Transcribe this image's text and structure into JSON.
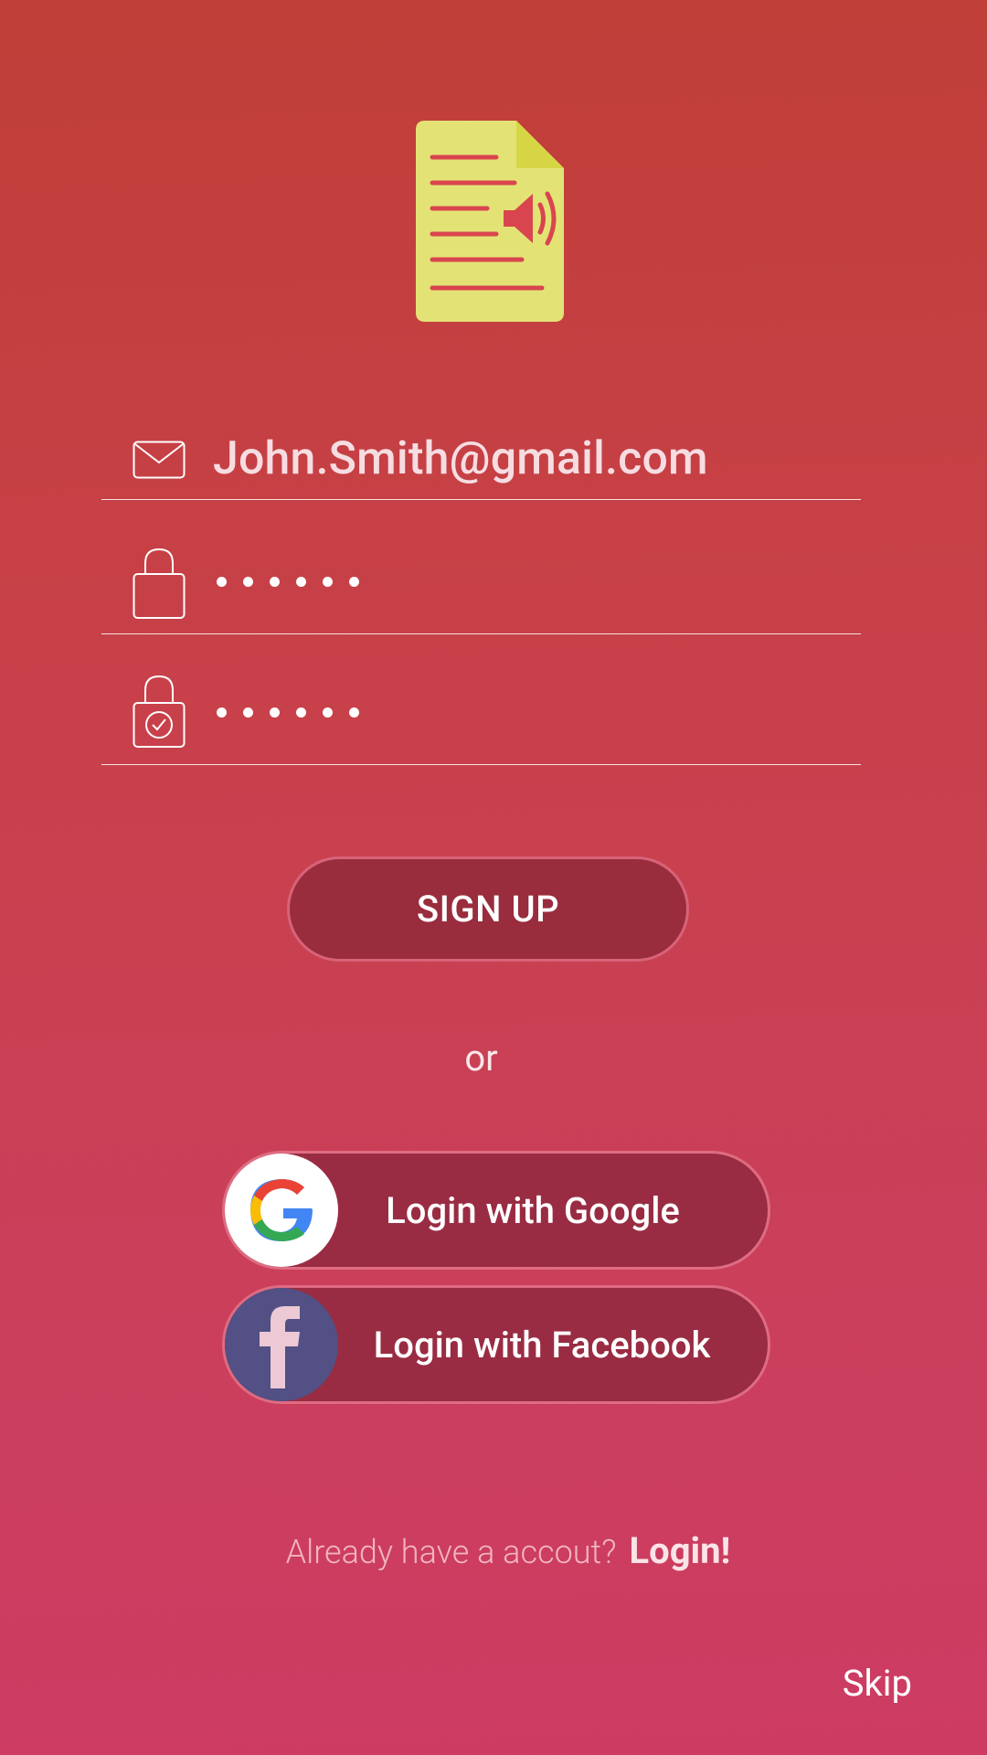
{
  "app": {
    "logo_icon": "document-speaker-icon",
    "colors": {
      "background_top": "#c03f38",
      "background_bottom": "#cd3b63",
      "logo_yellow": "#e3e375",
      "button_fill": "#992c3d",
      "facebook_blue": "#525085"
    }
  },
  "form": {
    "email": {
      "icon": "envelope-icon",
      "value": "John.Smith@gmail.com"
    },
    "password": {
      "icon": "lock-icon",
      "masked_value": "••••••"
    },
    "confirm_password": {
      "icon": "lock-check-icon",
      "masked_value": "••••••"
    },
    "signup_label": "SIGN UP"
  },
  "separator": "or",
  "social": {
    "google_label": "Login with Google",
    "google_icon": "google-g-icon",
    "facebook_label": "Login with Facebook",
    "facebook_icon": "facebook-f-icon"
  },
  "footer": {
    "already_text": "Already have a accout?",
    "login_label": "Login!",
    "skip_label": "Skip"
  }
}
